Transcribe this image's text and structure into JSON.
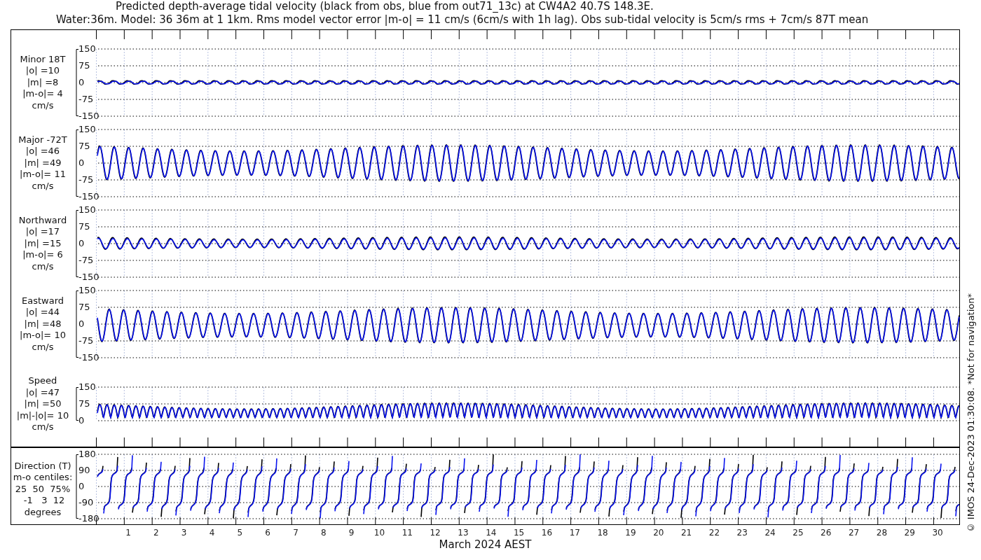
{
  "title_lines": [
    "Predicted depth-average tidal velocity (black from obs, blue from out71_13c) at CW4A2 40.7S 148.3E.",
    "Water:36m. Model: 36 36m at 1 1km. Rms model vector error |m-o| = 11 cm/s (6cm/s with 1h lag). Obs sub-tidal velocity is 5cm/s rms + 7cm/s 87T mean"
  ],
  "panels": [
    {
      "kind": "minor",
      "label": [
        "Minor 18T",
        "|o| =10",
        "|m| =8",
        "|m-o|= 4",
        "cm/s"
      ],
      "yticks": [
        "150",
        "75",
        "0",
        "-75",
        "-150"
      ]
    },
    {
      "kind": "major",
      "label": [
        "Major -72T",
        "|o| =46",
        "|m| =49",
        "|m-o|= 11",
        "cm/s"
      ],
      "yticks": [
        "150",
        "75",
        "0",
        "-75",
        "-150"
      ]
    },
    {
      "kind": "northward",
      "label": [
        "Northward",
        "|o| =17",
        "|m| =15",
        "|m-o|= 6",
        "cm/s"
      ],
      "yticks": [
        "150",
        "75",
        "0",
        "-75",
        "-150"
      ]
    },
    {
      "kind": "eastward",
      "label": [
        "Eastward",
        "|o| =44",
        "|m| =48",
        "|m-o|= 10",
        "cm/s"
      ],
      "yticks": [
        "150",
        "75",
        "0",
        "-75",
        "-150"
      ]
    },
    {
      "kind": "speed",
      "label": [
        "Speed",
        "|o| =47",
        "|m| =50",
        "|m|-|o|= 10",
        "cm/s"
      ],
      "yticks": [
        "150",
        "75",
        "0"
      ]
    }
  ],
  "direction_panel": {
    "kind": "direction",
    "label": [
      "Direction (T)",
      "m-o centiles:",
      "25  50  75%",
      " -1   3  12",
      "degrees"
    ],
    "yticks": [
      "180",
      "90",
      "0",
      "-90",
      "-180"
    ]
  },
  "x_tick_labels": [
    "1",
    "2",
    "3",
    "4",
    "5",
    "6",
    "7",
    "8",
    "9",
    "10",
    "11",
    "12",
    "13",
    "14",
    "15",
    "16",
    "17",
    "18",
    "19",
    "20",
    "21",
    "22",
    "23",
    "24",
    "25",
    "26",
    "27",
    "28",
    "29",
    "30"
  ],
  "xlabel": "March 2024 AEST",
  "copyright": "© IMOS 24-Dec-2023 01:30:08. *Not for navigation*"
}
